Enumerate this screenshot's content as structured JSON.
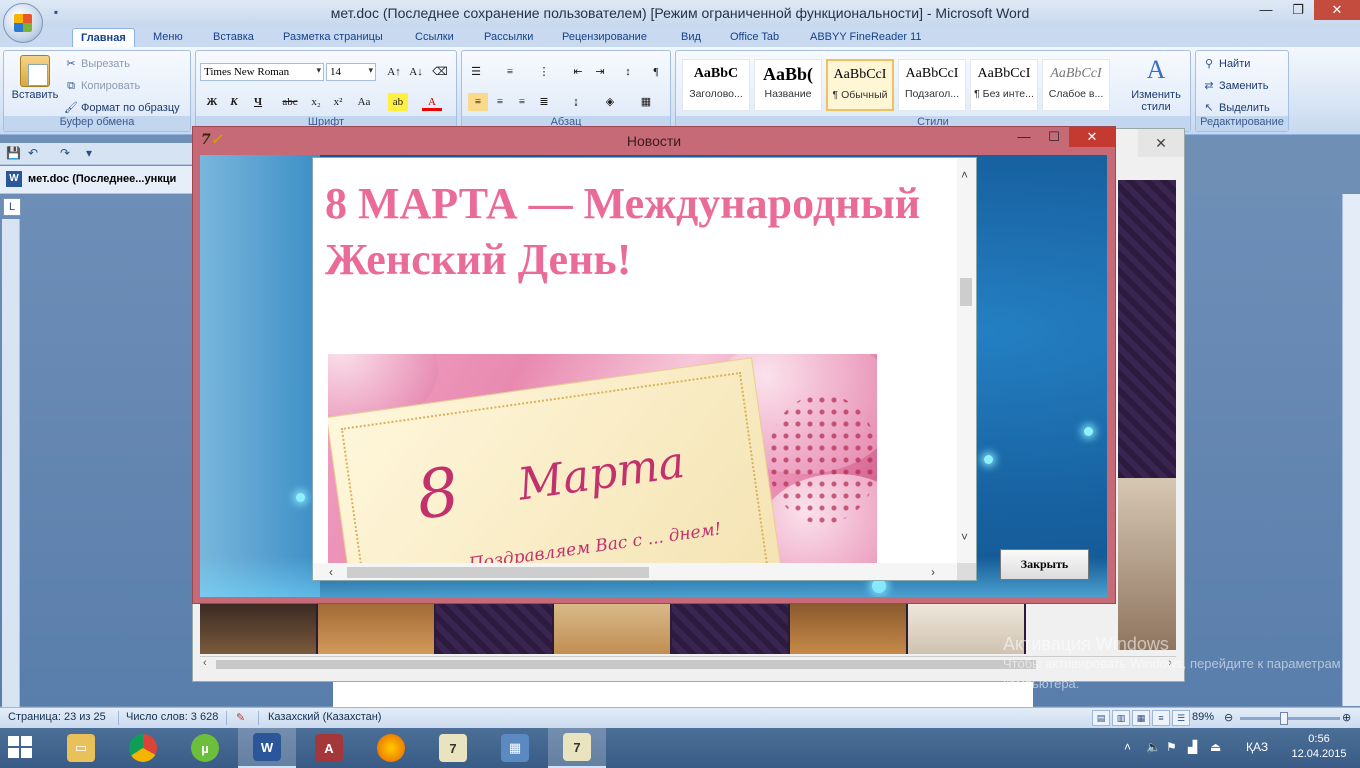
{
  "word": {
    "title": "мет.doc (Последнее сохранение пользователем) [Режим ограниченной функциональности] - Microsoft Word",
    "tabs": [
      "Главная",
      "Меню",
      "Вставка",
      "Разметка страницы",
      "Ссылки",
      "Рассылки",
      "Рецензирование",
      "Вид",
      "Office Tab",
      "ABBYY FineReader 11"
    ],
    "clipboard": {
      "paste": "Вставить",
      "cut": "Вырезать",
      "copy": "Копировать",
      "format_painter": "Формат по образцу",
      "group_label": "Буфер обмена"
    },
    "font": {
      "name": "Times New Roman",
      "size": "14",
      "group_label": "Шрифт"
    },
    "paragraph_group_label": "Абзац",
    "styles": [
      {
        "sample": "AaBbC",
        "name": "Заголово..."
      },
      {
        "sample": "AaBb(",
        "name": "Название"
      },
      {
        "sample": "AaBbCcI",
        "name": "¶ Обычный"
      },
      {
        "sample": "AaBbCcI",
        "name": "Подзагол..."
      },
      {
        "sample": "AaBbCcI",
        "name": "¶ Без инте..."
      },
      {
        "sample": "AaBbCcI",
        "name": "Слабое в..."
      }
    ],
    "styles_group_label": "Стили",
    "change_styles": "Изменить стили",
    "editing": {
      "find": "Найти",
      "replace": "Заменить",
      "select": "Выделить",
      "group_label": "Редактирование"
    },
    "doc_tab": "мет.doc (Последнее...ункци",
    "status": {
      "page": "Страница: 23 из 25",
      "words": "Число слов: 3 628",
      "language": "Казахский (Казахстан)",
      "zoom": "89%"
    },
    "activation": {
      "title": "Активация Windows",
      "message": "Чтобы активировать Windows, перейдите к параметрам компьютера."
    }
  },
  "news_window": {
    "title": "Новости",
    "heading": "8 МАРТА — Международный Женский День!",
    "card_number": "8",
    "card_word": "Марта",
    "card_greeting": "Поздравляем Вас с ... днем!",
    "close_button": "Закрыть"
  },
  "taskbar": {
    "apps": [
      "file-explorer",
      "chrome",
      "utorrent",
      "word",
      "access",
      "firefox",
      "app-7",
      "control-panel",
      "app-7-active"
    ],
    "language": "ҚАЗ",
    "time": "0:56",
    "date": "12.04.2015"
  },
  "colors": {
    "heading_pink": "#ea6b98",
    "modal_border": "#c56a76",
    "ribbon_blue": "#15428b"
  }
}
